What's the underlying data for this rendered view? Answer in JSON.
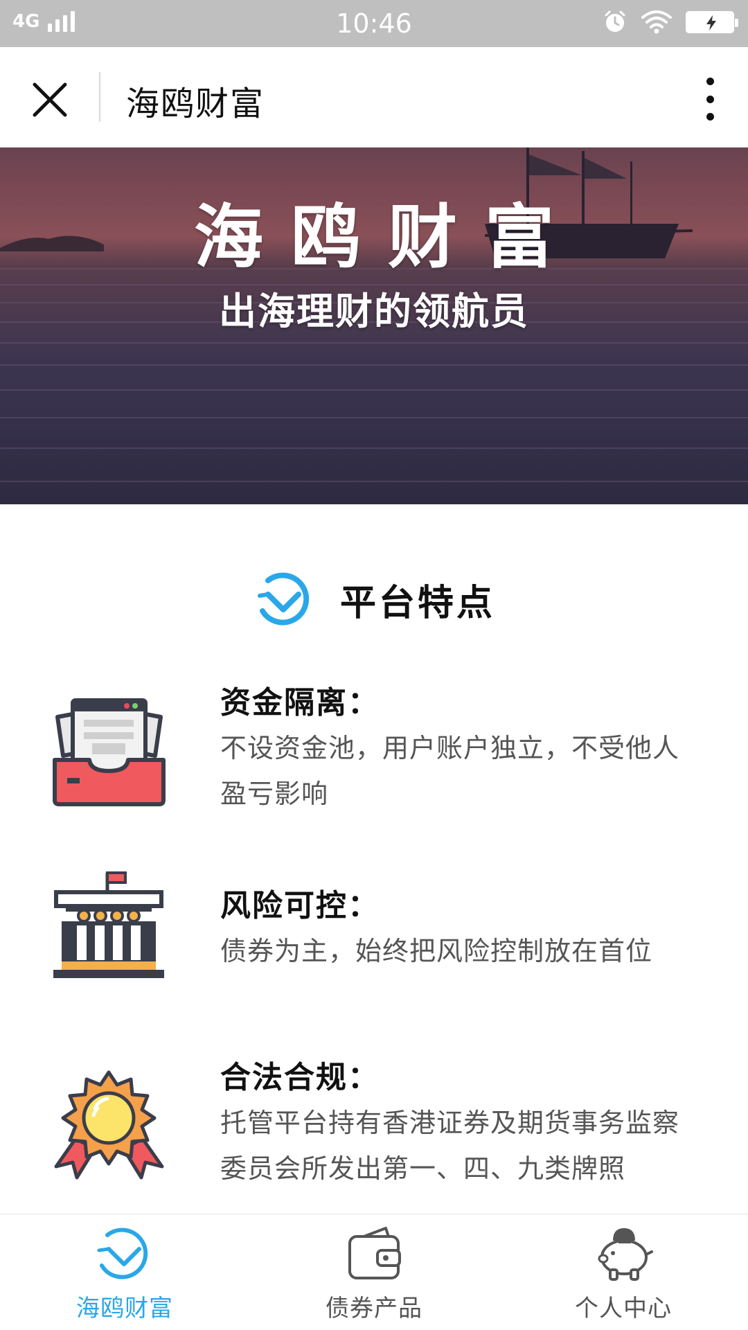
{
  "status_bar": {
    "network": "4G",
    "time": "10:46"
  },
  "header": {
    "title": "海鸥财富"
  },
  "banner": {
    "title": "海鸥财富",
    "subtitle": "出海理财的领航员"
  },
  "section": {
    "title": "平台特点"
  },
  "features": [
    {
      "icon": "inbox-tray-icon",
      "title": "资金隔离：",
      "desc": "不设资金池，用户账户独立，不受他人盈亏影响"
    },
    {
      "icon": "government-building-icon",
      "title": "风险可控：",
      "desc": "债券为主，始终把风险控制放在首位"
    },
    {
      "icon": "medal-icon",
      "title": "合法合规：",
      "desc": "托管平台持有香港证券及期货事务监察委员会所发出第一、四、九类牌照"
    }
  ],
  "bottom_nav": {
    "items": [
      {
        "label": "海鸥财富",
        "icon": "seagull-logo-icon",
        "active": true
      },
      {
        "label": "债券产品",
        "icon": "wallet-icon",
        "active": false
      },
      {
        "label": "个人中心",
        "icon": "piggy-bank-icon",
        "active": false
      }
    ]
  },
  "colors": {
    "accent": "#2aa7e8",
    "status_bar": "#bfbfbf",
    "text_primary": "#111111",
    "text_secondary": "#555555"
  }
}
